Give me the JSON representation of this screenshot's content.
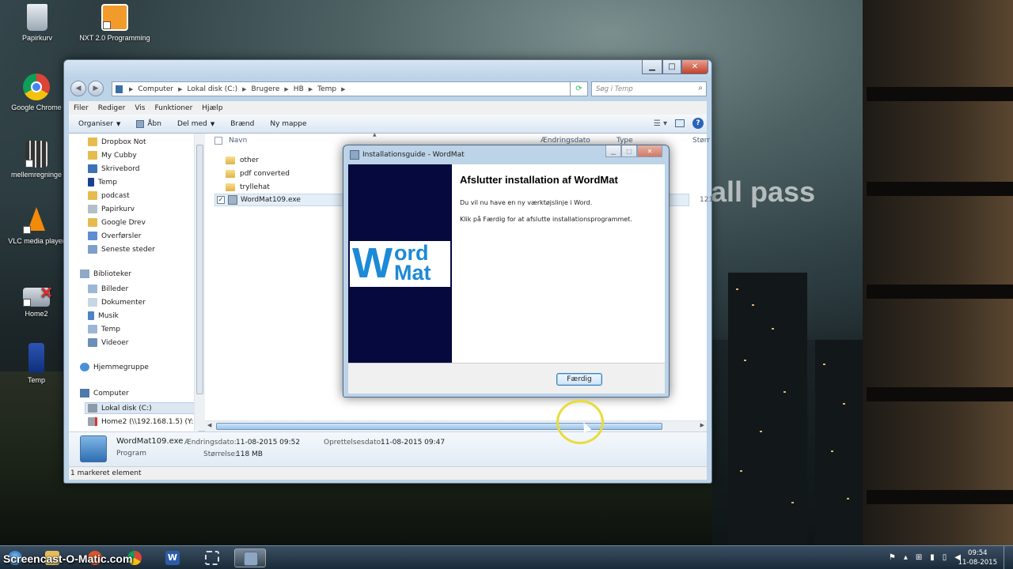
{
  "desktop": {
    "background_text": "all pass",
    "icons": [
      {
        "label": "Papirkurv",
        "icon": "recycle-bin-icon"
      },
      {
        "label": "NXT 2.0 Programming",
        "icon": "nxt-programming-icon"
      },
      {
        "label": "Google Chrome",
        "icon": "chrome-icon"
      },
      {
        "label": "mellemregninge",
        "icon": "calculator-icon"
      },
      {
        "label": "VLC media player",
        "icon": "vlc-icon"
      },
      {
        "label": "Home2",
        "icon": "network-drive-icon"
      },
      {
        "label": "Temp",
        "icon": "tardis-icon"
      }
    ]
  },
  "explorer": {
    "window_buttons": {
      "minimize": "▁",
      "maximize": "□",
      "close": "✕"
    },
    "breadcrumbs": [
      "Computer",
      "Lokal disk (C:)",
      "Brugere",
      "HB",
      "Temp"
    ],
    "search_placeholder": "Søg i Temp",
    "menu": [
      "Filer",
      "Rediger",
      "Vis",
      "Funktioner",
      "Hjælp"
    ],
    "commands": [
      "Organiser",
      "Åbn",
      "Del med",
      "Brænd",
      "Ny mappe"
    ],
    "nav_favorites": [
      "Dropbox Not",
      "My Cubby",
      "Skrivebord",
      "Temp",
      "podcast",
      "Papirkurv",
      "Google Drev",
      "Overførsler",
      "Seneste steder"
    ],
    "nav_libraries_title": "Biblioteker",
    "nav_libraries": [
      "Billeder",
      "Dokumenter",
      "Musik",
      "Temp",
      "Videoer"
    ],
    "nav_homegroup": "Hjemmegruppe",
    "nav_computer_title": "Computer",
    "nav_computer": [
      "Lokal disk (C:)",
      "Home2 (\\\\192.168.1.5) (Y:)"
    ],
    "columns": {
      "name": "Navn",
      "modified": "Ændringsdato",
      "type": "Type",
      "size": "Størr"
    },
    "files": [
      {
        "name": "other",
        "kind": "folder"
      },
      {
        "name": "pdf converted",
        "kind": "folder"
      },
      {
        "name": "tryllehat",
        "kind": "folder"
      },
      {
        "name": "WordMat109.exe",
        "kind": "exe",
        "checked": "✓",
        "size": "121"
      }
    ],
    "details": {
      "filename": "WordMat109.exe",
      "kind": "Program",
      "modified_label": "Ændringsdato:",
      "modified_value": "11-08-2015 09:52",
      "created_label": "Oprettelsesdato:",
      "created_value": "11-08-2015 09:47",
      "size_label": "Størrelse:",
      "size_value": "118 MB"
    },
    "status": "1 markeret element"
  },
  "dialog": {
    "title": "Installationsguide - WordMat",
    "heading": "Afslutter installation af WordMat",
    "line1": "Du vil nu have en ny værktøjslinje i Word.",
    "line2": "Klik på Færdig for at afslutte installationsprogrammet.",
    "finish_button": "Færdig",
    "logo": {
      "w": "W",
      "ord": "ord",
      "mat": "Mat"
    }
  },
  "taskbar": {
    "watermark": "Screencast-O-Matic.com",
    "time": "09:54",
    "date": "11-08-2015"
  },
  "colors": {
    "accent_blue": "#1c8ad6",
    "dialog_sidebar": "#05093d",
    "highlight_ring": "#e8dc3c"
  }
}
